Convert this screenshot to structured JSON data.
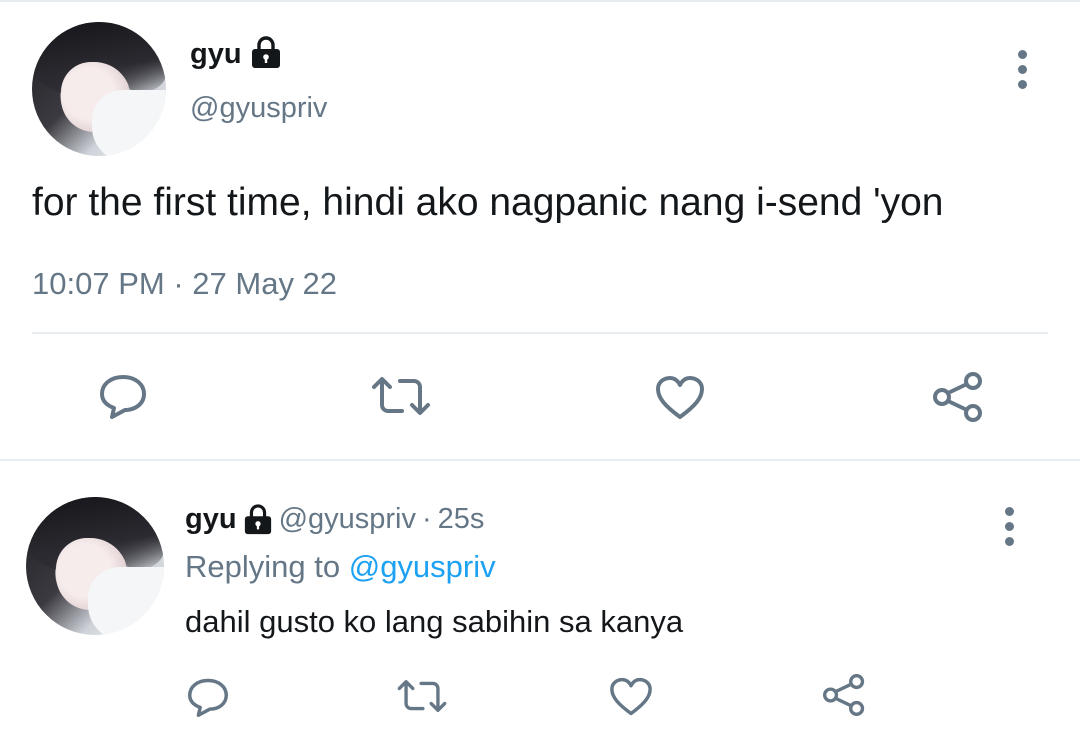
{
  "main_tweet": {
    "display_name": "gyu",
    "handle": "@gyuspriv",
    "text": "for the first time, hindi ako nagpanic nang i-send 'yon",
    "time": "10:07 PM",
    "date_separator": "·",
    "date": "27 May 22",
    "icons": {
      "lock": "lock-icon",
      "more": "more-vertical-icon",
      "reply": "reply-bubble-icon",
      "retweet": "retweet-icon",
      "like": "heart-icon",
      "share": "share-icon"
    }
  },
  "reply_tweet": {
    "display_name": "gyu",
    "handle": "@gyuspriv",
    "separator": "·",
    "age": "25s",
    "replying_prefix": "Replying to",
    "replying_to": "@gyuspriv",
    "text": "dahil gusto ko lang sabihin sa kanya"
  },
  "colors": {
    "text_primary": "#14171a",
    "text_secondary": "#657786",
    "link": "#1da1f2",
    "icon": "#657786",
    "divider": "#e6ecf0"
  }
}
